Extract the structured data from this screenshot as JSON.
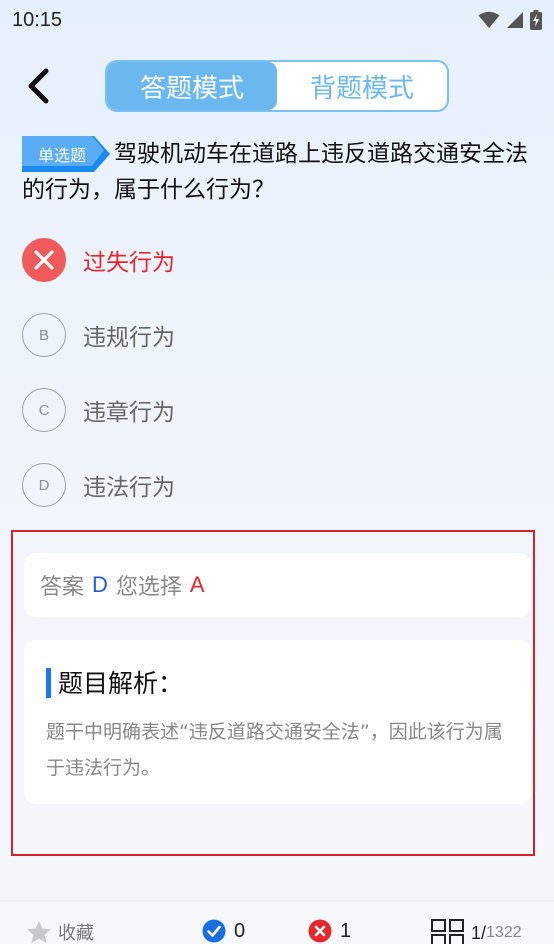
{
  "status": {
    "time": "10:15"
  },
  "header": {
    "tabs": [
      {
        "label": "答题模式",
        "active": true
      },
      {
        "label": "背题模式",
        "active": false
      }
    ]
  },
  "question": {
    "type_tag": "单选题",
    "text": "驾驶机动车在道路上违反道路交通安全法的行为，属于什么行为？"
  },
  "options": [
    {
      "letter": "A",
      "text": "过失行为",
      "state": "wrong"
    },
    {
      "letter": "B",
      "text": "违规行为",
      "state": "normal"
    },
    {
      "letter": "C",
      "text": "违章行为",
      "state": "normal"
    },
    {
      "letter": "D",
      "text": "违法行为",
      "state": "normal"
    }
  ],
  "answer": {
    "label": "答案",
    "correct": "D",
    "your_choice_label": "您选择",
    "your_choice": "A"
  },
  "explanation": {
    "title": "题目解析：",
    "text": "题干中明确表述“违反道路交通安全法”，因此该行为属于违法行为。"
  },
  "bottom_bar": {
    "favorite_label": "收藏",
    "right_count": "0",
    "wrong_count": "1",
    "progress_current": "1/",
    "progress_total": "1322"
  },
  "colors": {
    "accent": "#6ab8ef",
    "wrong": "#e8252b",
    "correct": "#1a5fd6",
    "frame": "#d2232a"
  }
}
